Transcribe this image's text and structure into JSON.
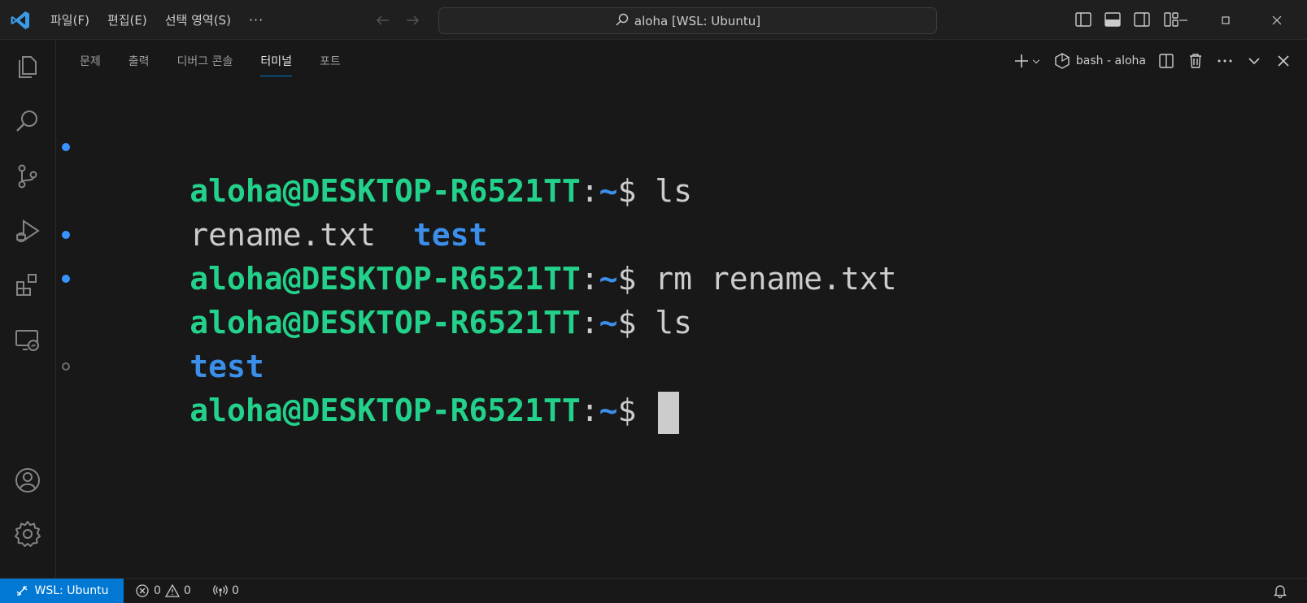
{
  "titlebar": {
    "menu": [
      "파일(F)",
      "편집(E)",
      "선택 영역(S)"
    ],
    "more": "···",
    "command_center": "aloha [WSL: Ubuntu]"
  },
  "panel": {
    "tabs": [
      "문제",
      "출력",
      "디버그 콘솔",
      "터미널",
      "포트"
    ],
    "active_tab": "터미널",
    "terminal_name": "bash - aloha"
  },
  "terminal": {
    "prompt_user": "aloha@DESKTOP-R6521TT",
    "prompt_colon": ":",
    "prompt_tilde": "~",
    "prompt_dollar": "$ ",
    "lines": [
      {
        "type": "prompt",
        "cmd": "ls"
      },
      {
        "type": "output",
        "file": "rename.txt  ",
        "dir": "test"
      },
      {
        "type": "prompt",
        "cmd": "rm rename.txt"
      },
      {
        "type": "prompt",
        "cmd": "ls"
      },
      {
        "type": "output",
        "file": "",
        "dir": "test"
      },
      {
        "type": "prompt",
        "cmd": ""
      }
    ]
  },
  "statusbar": {
    "remote": "WSL: Ubuntu",
    "errors": "0",
    "warnings": "0",
    "ports": "0"
  },
  "colors": {
    "accent": "#0078d4",
    "prompt_user": "#23d18b",
    "prompt_path": "#3b8eea"
  }
}
